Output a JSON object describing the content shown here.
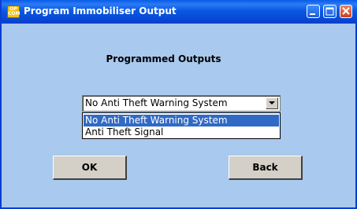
{
  "window": {
    "title": "Program Immobiliser Output",
    "icon_line1": "OP",
    "icon_line2": "COM",
    "icon_name": "opcom-app-icon",
    "caption_buttons": [
      "minimize",
      "maximize",
      "close"
    ]
  },
  "main": {
    "heading": "Programmed Outputs",
    "dropdown": {
      "selected_value": "No Anti Theft Warning System",
      "options": [
        {
          "label": "No Anti Theft Warning System",
          "highlighted": true
        },
        {
          "label": "Anti Theft Signal",
          "highlighted": false
        }
      ]
    },
    "buttons": {
      "ok_label": "OK",
      "back_label": "Back"
    }
  },
  "colors": {
    "background": "#A9C9EE",
    "titlebar": "#0A5BE8",
    "selection": "#316AC5",
    "button_face": "#D4D0C8",
    "close_button": "#C8401E"
  }
}
